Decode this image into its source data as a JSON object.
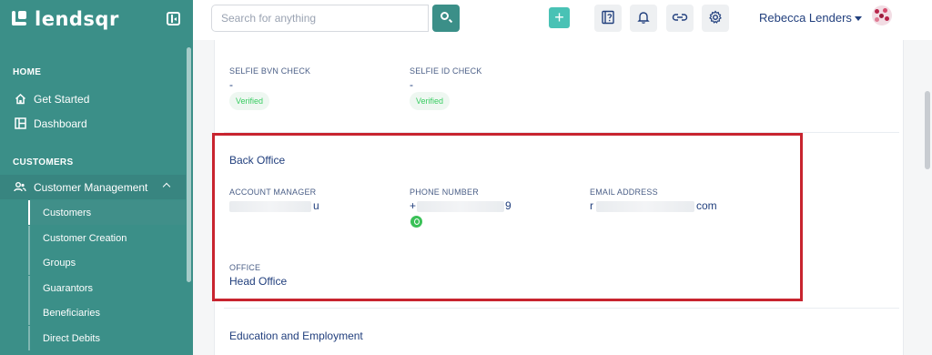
{
  "brand": {
    "name": "lendsqr"
  },
  "search": {
    "placeholder": "Search for anything"
  },
  "user": {
    "name": "Rebecca Lenders"
  },
  "sidebar": {
    "home_heading": "HOME",
    "home_items": [
      {
        "label": "Get Started",
        "icon": "home-icon"
      },
      {
        "label": "Dashboard",
        "icon": "dashboard-icon"
      }
    ],
    "customers_heading": "CUSTOMERS",
    "customer_group": {
      "label": "Customer Management",
      "icon": "users-icon"
    },
    "customer_items": [
      {
        "label": "Customers",
        "active": true
      },
      {
        "label": "Customer Creation"
      },
      {
        "label": "Groups"
      },
      {
        "label": "Guarantors"
      },
      {
        "label": "Beneficiaries"
      },
      {
        "label": "Direct Debits"
      }
    ]
  },
  "checks": [
    {
      "label": "SELFIE BVN CHECK",
      "value": "-",
      "status": "Verified"
    },
    {
      "label": "SELFIE ID CHECK",
      "value": "-",
      "status": "Verified"
    }
  ],
  "back_office": {
    "title": "Back Office",
    "account_manager": {
      "label": "ACCOUNT MANAGER",
      "value_visible": "u"
    },
    "phone": {
      "label": "PHONE NUMBER",
      "value_start": "+",
      "value_end": "9"
    },
    "email": {
      "label": "EMAIL ADDRESS",
      "value_start": "r",
      "value_end": "com"
    },
    "office": {
      "label": "OFFICE",
      "value": "Head Office"
    }
  },
  "education": {
    "title": "Education and Employment"
  },
  "colors": {
    "sidebar": "#3b8f88",
    "accent": "#49c2b5",
    "highlight_border": "#c8242f",
    "text": "#213f7d",
    "verified": "#39cd62"
  }
}
